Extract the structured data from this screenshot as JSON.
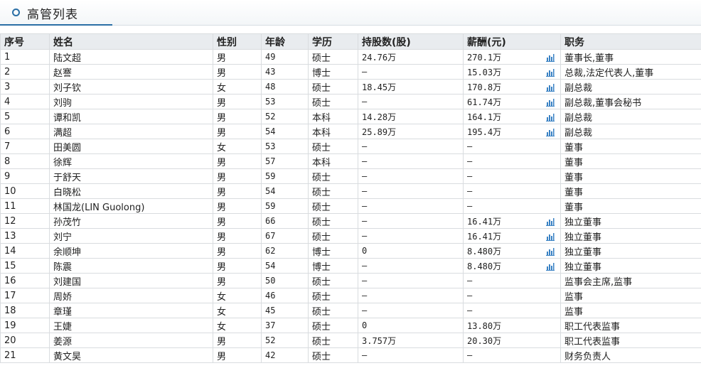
{
  "panel": {
    "title": "高管列表"
  },
  "table": {
    "headers": [
      "序号",
      "姓名",
      "性别",
      "年龄",
      "学历",
      "持股数(股)",
      "薪酬(元)",
      "职务"
    ],
    "rows": [
      {
        "idx": "1",
        "name": "陆文超",
        "gender": "男",
        "age": "49",
        "edu": "硕士",
        "shares": "24.76万",
        "salary": "270.1万",
        "chart": true,
        "title": "董事长,董事"
      },
      {
        "idx": "2",
        "name": "赵謇",
        "gender": "男",
        "age": "43",
        "edu": "博士",
        "shares": "—",
        "salary": "15.03万",
        "chart": true,
        "title": "总裁,法定代表人,董事"
      },
      {
        "idx": "3",
        "name": "刘子钦",
        "gender": "女",
        "age": "48",
        "edu": "硕士",
        "shares": "18.45万",
        "salary": "170.8万",
        "chart": true,
        "title": "副总裁"
      },
      {
        "idx": "4",
        "name": "刘驹",
        "gender": "男",
        "age": "53",
        "edu": "硕士",
        "shares": "—",
        "salary": "61.74万",
        "chart": true,
        "title": "副总裁,董事会秘书"
      },
      {
        "idx": "5",
        "name": "谭和凯",
        "gender": "男",
        "age": "52",
        "edu": "本科",
        "shares": "14.28万",
        "salary": "164.1万",
        "chart": true,
        "title": "副总裁"
      },
      {
        "idx": "6",
        "name": "满超",
        "gender": "男",
        "age": "54",
        "edu": "本科",
        "shares": "25.89万",
        "salary": "195.4万",
        "chart": true,
        "title": "副总裁"
      },
      {
        "idx": "7",
        "name": "田美圆",
        "gender": "女",
        "age": "53",
        "edu": "硕士",
        "shares": "—",
        "salary": "—",
        "chart": false,
        "title": "董事"
      },
      {
        "idx": "8",
        "name": "徐辉",
        "gender": "男",
        "age": "57",
        "edu": "本科",
        "shares": "—",
        "salary": "—",
        "chart": false,
        "title": "董事"
      },
      {
        "idx": "9",
        "name": "于舒天",
        "gender": "男",
        "age": "59",
        "edu": "硕士",
        "shares": "—",
        "salary": "—",
        "chart": false,
        "title": "董事"
      },
      {
        "idx": "10",
        "name": "白晓松",
        "gender": "男",
        "age": "54",
        "edu": "硕士",
        "shares": "—",
        "salary": "—",
        "chart": false,
        "title": "董事"
      },
      {
        "idx": "11",
        "name": "林国龙(LIN Guolong)",
        "gender": "男",
        "age": "59",
        "edu": "硕士",
        "shares": "—",
        "salary": "—",
        "chart": false,
        "title": "董事"
      },
      {
        "idx": "12",
        "name": "孙茂竹",
        "gender": "男",
        "age": "66",
        "edu": "硕士",
        "shares": "—",
        "salary": "16.41万",
        "chart": true,
        "title": "独立董事"
      },
      {
        "idx": "13",
        "name": "刘宁",
        "gender": "男",
        "age": "67",
        "edu": "硕士",
        "shares": "—",
        "salary": "16.41万",
        "chart": true,
        "title": "独立董事"
      },
      {
        "idx": "14",
        "name": "余顺坤",
        "gender": "男",
        "age": "62",
        "edu": "博士",
        "shares": "0",
        "salary": "8.480万",
        "chart": true,
        "title": "独立董事"
      },
      {
        "idx": "15",
        "name": "陈震",
        "gender": "男",
        "age": "54",
        "edu": "博士",
        "shares": "—",
        "salary": "8.480万",
        "chart": true,
        "title": "独立董事"
      },
      {
        "idx": "16",
        "name": "刘建国",
        "gender": "男",
        "age": "50",
        "edu": "硕士",
        "shares": "—",
        "salary": "—",
        "chart": false,
        "title": "监事会主席,监事"
      },
      {
        "idx": "17",
        "name": "周娇",
        "gender": "女",
        "age": "46",
        "edu": "硕士",
        "shares": "—",
        "salary": "—",
        "chart": false,
        "title": "监事"
      },
      {
        "idx": "18",
        "name": "章瑾",
        "gender": "女",
        "age": "45",
        "edu": "硕士",
        "shares": "—",
        "salary": "—",
        "chart": false,
        "title": "监事"
      },
      {
        "idx": "19",
        "name": "王婕",
        "gender": "女",
        "age": "37",
        "edu": "硕士",
        "shares": "0",
        "salary": "13.80万",
        "chart": false,
        "title": "职工代表监事"
      },
      {
        "idx": "20",
        "name": "姜源",
        "gender": "男",
        "age": "52",
        "edu": "硕士",
        "shares": "3.757万",
        "salary": "20.30万",
        "chart": false,
        "title": "职工代表监事"
      },
      {
        "idx": "21",
        "name": "黄文昊",
        "gender": "男",
        "age": "42",
        "edu": "硕士",
        "shares": "—",
        "salary": "—",
        "chart": false,
        "title": "财务负责人"
      }
    ]
  },
  "colors": {
    "accent": "#2a6fa6",
    "chart_icon": "#3a82c4"
  },
  "icons": {
    "salary_chart": "bar-chart-icon"
  }
}
